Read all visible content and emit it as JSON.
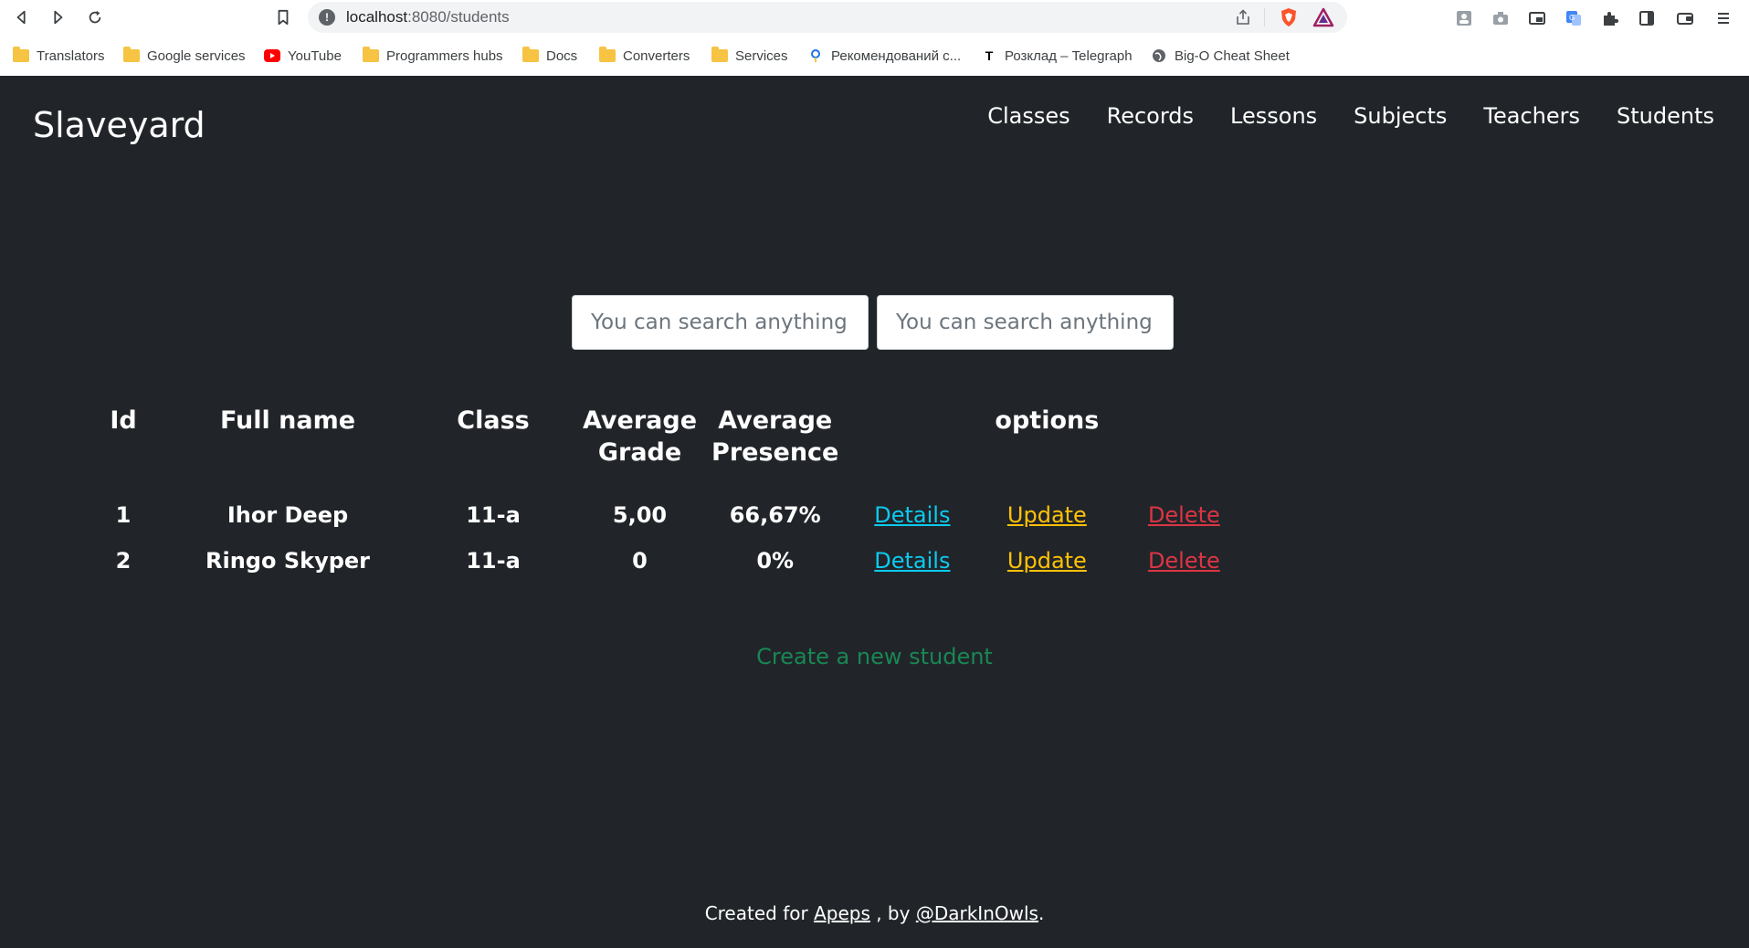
{
  "browser": {
    "url_host": "localhost",
    "url_path": ":8080/students",
    "bookmarks": [
      {
        "label": "Translators",
        "icon": "folder-icon"
      },
      {
        "label": "Google services",
        "icon": "folder-icon"
      },
      {
        "label": "YouTube",
        "icon": "youtube-icon"
      },
      {
        "label": "Programmers hubs",
        "icon": "folder-icon"
      },
      {
        "label": "Docs",
        "icon": "folder-icon"
      },
      {
        "label": "Converters",
        "icon": "folder-icon"
      },
      {
        "label": "Services",
        "icon": "folder-icon"
      },
      {
        "label": "Рекомендований с...",
        "icon": "pin-icon"
      },
      {
        "label": "Розклад – Telegraph",
        "icon": "telegraph-icon"
      },
      {
        "label": "Big-O Cheat Sheet",
        "icon": "globe-icon"
      }
    ]
  },
  "header": {
    "brand": "Slaveyard",
    "nav": [
      "Classes",
      "Records",
      "Lessons",
      "Subjects",
      "Teachers",
      "Students"
    ]
  },
  "search": {
    "placeholder_1": "You can search anything!",
    "placeholder_2": "You can search anything!"
  },
  "table": {
    "columns": {
      "id": "Id",
      "full_name": "Full name",
      "class": "Class",
      "average_grade_1": "Average",
      "average_grade_2": "Grade",
      "average_presence_1": "Average",
      "average_presence_2": "Presence",
      "options": "options"
    },
    "rows": [
      {
        "id": "1",
        "full_name": "Ihor Deep",
        "class": "11-a",
        "average_grade": "5,00",
        "average_presence": "66,67%",
        "details": "Details",
        "update": "Update",
        "delete": "Delete"
      },
      {
        "id": "2",
        "full_name": "Ringo Skyper",
        "class": "11-a",
        "average_grade": "0",
        "average_presence": "0%",
        "details": "Details",
        "update": "Update",
        "delete": "Delete"
      }
    ]
  },
  "create_link": "Create a new student",
  "footer": {
    "prefix": "Created for",
    "link_1": "Apeps",
    "middle": ", by",
    "link_2": "@DarkInOwls",
    "suffix": "."
  },
  "colors": {
    "background": "#212529",
    "details": "#0dcaf0",
    "update": "#ffc107",
    "delete": "#dc3545",
    "create": "#198754"
  }
}
